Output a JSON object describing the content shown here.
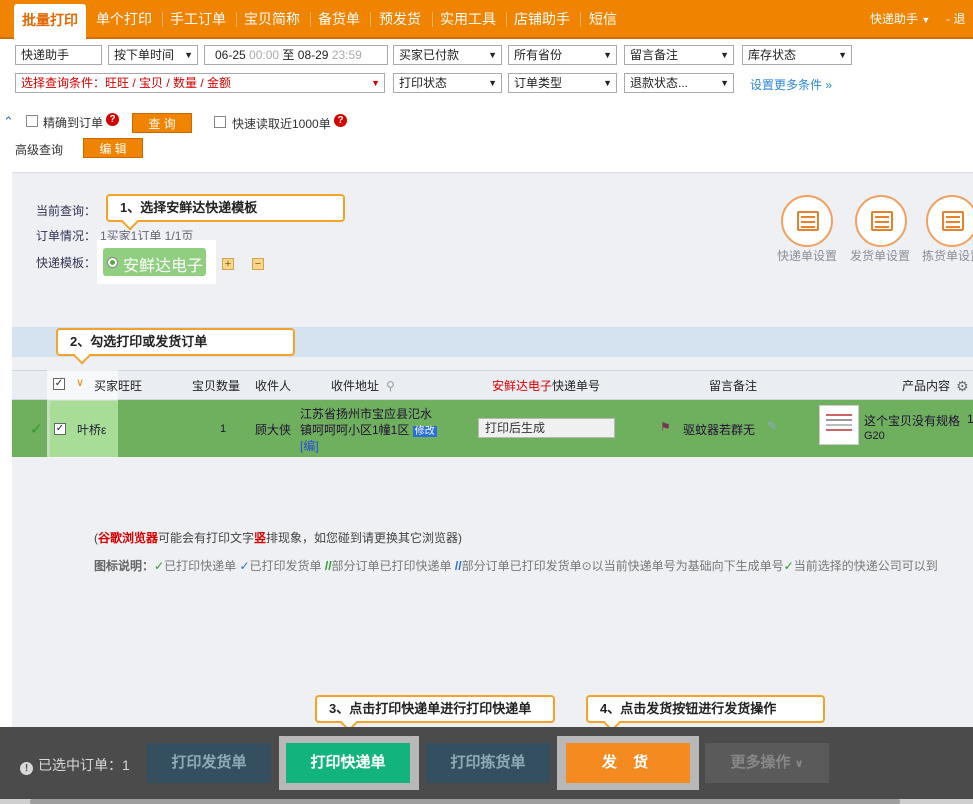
{
  "nav": {
    "tabs": [
      "批量打印",
      "单个打印",
      "手工订单",
      "宝贝简称",
      "备货单",
      "预发货",
      "实用工具",
      "店铺助手",
      "短信"
    ],
    "right_user": "快递助手",
    "right_exit": "退出"
  },
  "filters": {
    "row1": {
      "helper": "快递助手",
      "time_sort": "按下单时间",
      "date_from": "06-25",
      "time_from": "00:00",
      "date_to_sep": "至",
      "date_to": "08-29",
      "time_to": "23:59",
      "pay_status": "买家已付款",
      "province": "所有省份",
      "message_note": "留言备注",
      "stock_status": "库存状态"
    },
    "row2": {
      "query_condition": "选择查询条件：旺旺 / 宝贝 / 数量 / 金额",
      "print_status": "打印状态",
      "order_type": "订单类型",
      "refund_status": "退款状态...",
      "more_link": "设置更多条件 »"
    },
    "row3": {
      "exact_label": "精确到订单",
      "query_button": "查 询",
      "fast_read_label": "快速读取近1000单"
    },
    "row4": {
      "advanced_label": "高级查询",
      "edit_button": "编 辑"
    }
  },
  "panel": {
    "current_query_label": "当前查询：",
    "order_status_label": "订单情况：",
    "order_status_value": "1买家1订单  1/1页",
    "template_label": "快递模板：",
    "template_chip": "安鲜达电子",
    "plus": "+",
    "minus": "−",
    "icons": [
      {
        "name": "express-settings-icon",
        "label": "快递单设置"
      },
      {
        "name": "delivery-settings-icon",
        "label": "发货单设置"
      },
      {
        "name": "picking-settings-icon",
        "label": "拣货单设置"
      }
    ]
  },
  "callouts": {
    "c1": "1、选择安鲜达快递模板",
    "c2": "2、勾选打印或发货订单",
    "c3": "3、点击打印快递单进行打印快递单",
    "c4": "4、点击发货按钮进行发货操作"
  },
  "table": {
    "headers": {
      "buyer": "买家旺旺",
      "qty": "宝贝数量",
      "receiver": "收件人",
      "address": "收件地址",
      "tracking_prefix": "安鲜达电子",
      "tracking_suffix": "快递单号",
      "message": "留言备注",
      "product": "产品内容"
    },
    "rows": [
      {
        "buyer": "叶桥ε",
        "qty": "1",
        "receiver": "顾大侠",
        "address_line1": "江苏省扬州市宝应县氾水",
        "address_line2": "镇呵呵呵小区1幢1区",
        "address_edit": "修改",
        "address_tail": "编",
        "tracking": "打印后生成",
        "message": "驱蚊器若群无",
        "product_title": "这个宝贝没有规格",
        "product_sub": "G20",
        "product_qty": "1"
      }
    ]
  },
  "notes": {
    "browser_prefix": "(",
    "browser_name": "谷歌浏览器",
    "browser_mid": "可能会有打印文字",
    "browser_bold": "竖",
    "browser_suffix": "排现象，如您碰到请更换其它浏览器)",
    "legend_label": "图标说明：",
    "legend_items": [
      "已打印快递单",
      "已打印发货单",
      "部分订单已打印快递单",
      "部分订单已打印发货单",
      "以当前快递单号为基础向下生成单号",
      "当前选择的快递公司可以到"
    ]
  },
  "bottom": {
    "selected_label": "已选中订单：1",
    "btn_print_delivery": "打印发货单",
    "btn_print_express": "打印快递单",
    "btn_print_picking": "打印拣货单",
    "btn_ship": "发 货",
    "btn_more": "更多操作"
  },
  "colors": {
    "brand_orange": "#f08300",
    "row_green": "#6fb05f",
    "btn_green": "#13b37d",
    "btn_orange": "#f58a21",
    "callout_border": "#f3a32a"
  }
}
